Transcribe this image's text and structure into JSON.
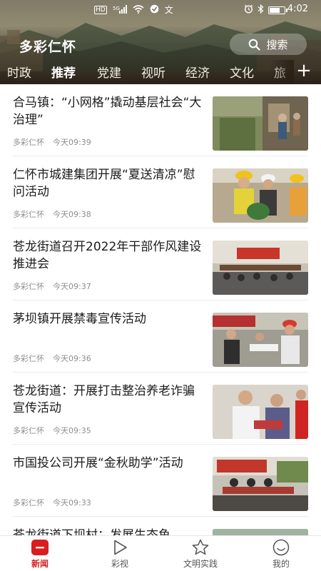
{
  "status_bar": {
    "left_icons": [
      "hd-icon",
      "signal-4g-icon",
      "wifi-icon",
      "app-notification-icon",
      "translate-icon"
    ],
    "hd_label": "HD",
    "net_label": "5G",
    "translate_glyph": "文",
    "time": "4:02",
    "battery_level": 0.75
  },
  "header": {
    "app_title": "多彩仁怀",
    "search_label": "搜索"
  },
  "tabs": [
    {
      "label": "时政",
      "active": false
    },
    {
      "label": "推荐",
      "active": true
    },
    {
      "label": "党建",
      "active": false
    },
    {
      "label": "视听",
      "active": false
    },
    {
      "label": "经济",
      "active": false
    },
    {
      "label": "文化",
      "active": false
    },
    {
      "label": "旅",
      "active": false
    }
  ],
  "plus_label": "+",
  "news": [
    {
      "title": "合马镇：“小网格”撬动基层社会“大治理”",
      "source": "多彩仁怀",
      "time": "今天09:39"
    },
    {
      "title": "仁怀市城建集团开展“夏送清凉”慰问活动",
      "source": "多彩仁怀",
      "time": "今天09:38"
    },
    {
      "title": "苍龙街道召开2022年干部作风建设推进会",
      "source": "多彩仁怀",
      "time": "今天09:37"
    },
    {
      "title": "茅坝镇开展禁毒宣传活动",
      "source": "多彩仁怀",
      "time": "今天09:36"
    },
    {
      "title": "苍龙街道：开展打击整治养老诈骗宣传活动",
      "source": "多彩仁怀",
      "time": "今天09:35"
    },
    {
      "title": "市国投公司开展“金秋助学”活动",
      "source": "多彩仁怀",
      "time": "今天09:33"
    },
    {
      "title": "苍龙街道下坝村：发展生态鱼",
      "source": "",
      "time": ""
    }
  ],
  "bottom_nav": [
    {
      "label": "新闻",
      "icon": "news-icon",
      "active": true
    },
    {
      "label": "彩视",
      "icon": "play-icon",
      "active": false
    },
    {
      "label": "文明实践",
      "icon": "star-icon",
      "active": false
    },
    {
      "label": "我的",
      "icon": "smile-face-icon",
      "active": false
    }
  ],
  "colors": {
    "accent": "#d81e1e",
    "meta_text": "#8e8e8e",
    "divider": "#ececec"
  }
}
